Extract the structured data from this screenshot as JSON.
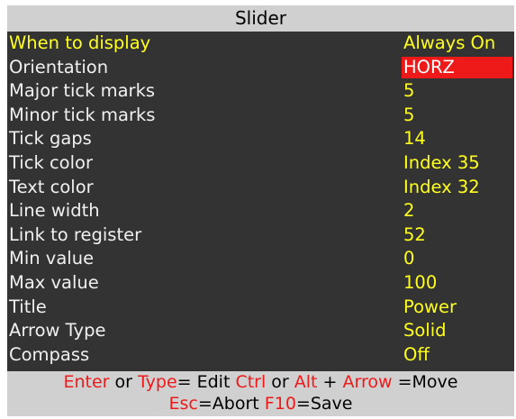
{
  "window": {
    "title": "Slider"
  },
  "colors": {
    "label": "#f0f0f0",
    "value": "#ffff20",
    "selected_bg": "#ee1a1a",
    "key": "#ee1a1a",
    "bar_bg": "#d0d0d0",
    "panel_bg": "#333333"
  },
  "rows": [
    {
      "label": "When to display",
      "value": "Always On"
    },
    {
      "label": "Orientation",
      "value": "HORZ"
    },
    {
      "label": "Major tick marks",
      "value": "5"
    },
    {
      "label": "Minor tick marks",
      "value": "5"
    },
    {
      "label": "Tick gaps",
      "value": "14"
    },
    {
      "label": "Tick color",
      "value": "Index 35"
    },
    {
      "label": "Text color",
      "value": "Index 32"
    },
    {
      "label": "Line width",
      "value": "2"
    },
    {
      "label": "Link to register",
      "value": "52"
    },
    {
      "label": "Min value",
      "value": "0"
    },
    {
      "label": "Max value",
      "value": "100"
    },
    {
      "label": "Title",
      "value": "Power"
    },
    {
      "label": "Arrow Type",
      "value": "Solid"
    },
    {
      "label": "Compass",
      "value": "Off"
    }
  ],
  "footer": {
    "line1": {
      "enter": "Enter",
      "or1": " or ",
      "type": "Type",
      "edit": "= Edit ",
      "ctrl": "Ctrl",
      "or2": " or ",
      "alt": "Alt",
      "plus": " + ",
      "arrow": "Arrow",
      "move": " =Move"
    },
    "line2": {
      "esc": "Esc",
      "abort": "=Abort ",
      "f10": "F10",
      "save": "=Save"
    }
  }
}
